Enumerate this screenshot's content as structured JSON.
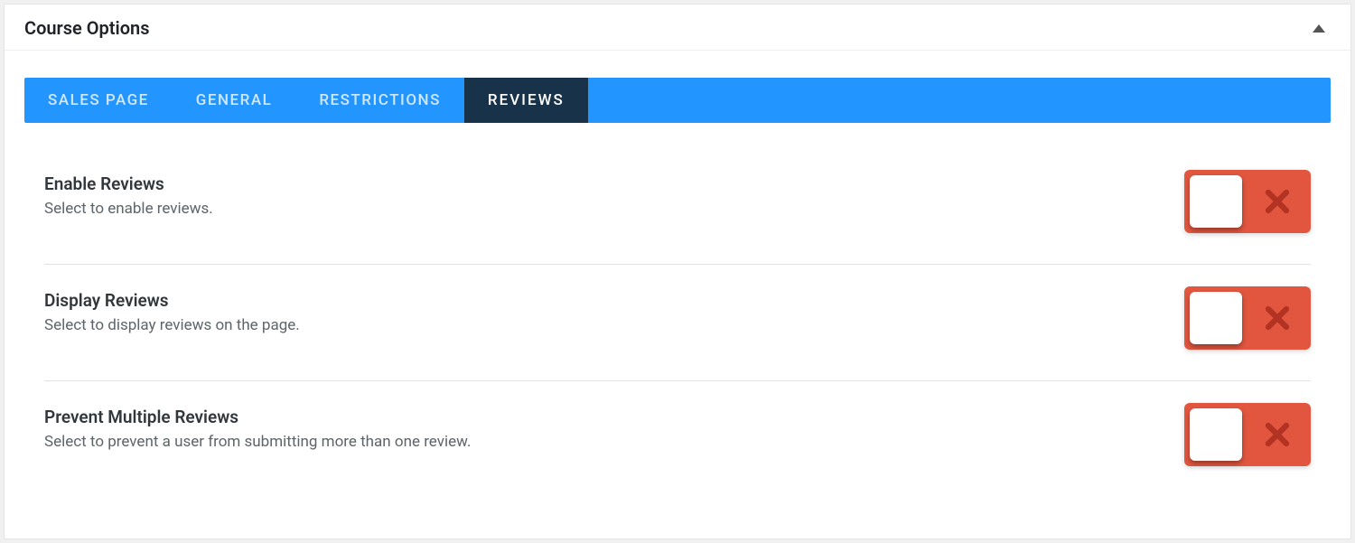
{
  "panel": {
    "title": "Course Options"
  },
  "tabs": [
    {
      "label": "SALES PAGE",
      "active": false
    },
    {
      "label": "GENERAL",
      "active": false
    },
    {
      "label": "RESTRICTIONS",
      "active": false
    },
    {
      "label": "REVIEWS",
      "active": true
    }
  ],
  "settings": [
    {
      "title": "Enable Reviews",
      "desc": "Select to enable reviews.",
      "value": false
    },
    {
      "title": "Display Reviews",
      "desc": "Select to display reviews on the page.",
      "value": false
    },
    {
      "title": "Prevent Multiple Reviews",
      "desc": "Select to prevent a user from submitting more than one review.",
      "value": false
    }
  ],
  "colors": {
    "tab_bg": "#2295ff",
    "tab_active_bg": "#18324a",
    "toggle_off_bg": "#e2563f"
  }
}
